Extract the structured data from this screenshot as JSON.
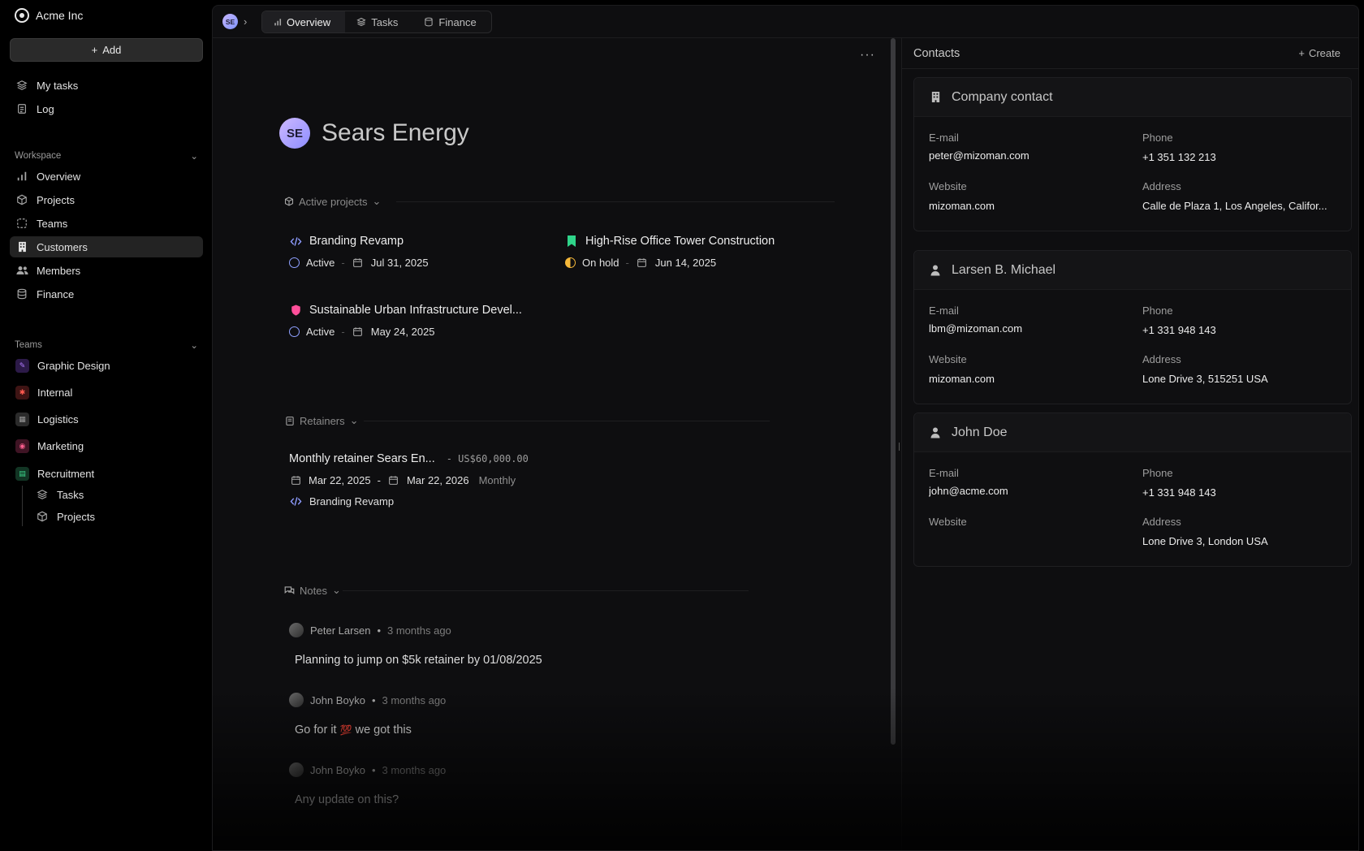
{
  "org": {
    "name": "Acme Inc"
  },
  "sidebar": {
    "add_label": "Add",
    "top_items": [
      {
        "label": "My tasks",
        "icon": "layers-icon"
      },
      {
        "label": "Log",
        "icon": "log-icon"
      }
    ],
    "workspace": {
      "heading": "Workspace",
      "items": [
        {
          "label": "Overview",
          "icon": "chart-icon"
        },
        {
          "label": "Projects",
          "icon": "box-icon"
        },
        {
          "label": "Teams",
          "icon": "teams-icon"
        },
        {
          "label": "Customers",
          "icon": "building-icon",
          "active": true
        },
        {
          "label": "Members",
          "icon": "members-icon"
        },
        {
          "label": "Finance",
          "icon": "database-icon"
        }
      ]
    },
    "teams": {
      "heading": "Teams",
      "items": [
        {
          "label": "Graphic Design",
          "color": "#8a4cf0"
        },
        {
          "label": "Internal",
          "color": "#e0413a"
        },
        {
          "label": "Logistics",
          "color": "#6f6f6f"
        },
        {
          "label": "Marketing",
          "color": "#e8457a"
        },
        {
          "label": "Recruitment",
          "color": "#2fbf71"
        }
      ],
      "sub_items": [
        {
          "label": "Tasks"
        },
        {
          "label": "Projects"
        }
      ]
    }
  },
  "topbar": {
    "avatar_initials": "SE",
    "tabs": [
      {
        "label": "Overview",
        "active": true
      },
      {
        "label": "Tasks"
      },
      {
        "label": "Finance"
      }
    ]
  },
  "customer": {
    "initials": "SE",
    "name": "Sears Energy"
  },
  "active_projects": {
    "heading": "Active projects",
    "projects": [
      {
        "name": "Branding Revamp",
        "status": "Active",
        "date": "Jul 31, 2025",
        "icon": "code-icon"
      },
      {
        "name": "High-Rise Office Tower Construction",
        "status": "On hold",
        "date": "Jun 14, 2025",
        "icon": "bookmark-icon"
      },
      {
        "name": "Sustainable Urban Infrastructure Devel...",
        "status": "Active",
        "date": "May 24, 2025",
        "icon": "shield-icon"
      }
    ]
  },
  "retainers": {
    "heading": "Retainers",
    "items": [
      {
        "name": "Monthly retainer Sears En...",
        "amount": "- US$60,000.00",
        "start": "Mar 22, 2025",
        "end": "Mar 22, 2026",
        "dash": "-",
        "frequency": "Monthly",
        "project": "Branding Revamp"
      }
    ]
  },
  "notes": {
    "heading": "Notes",
    "items": [
      {
        "author": "Peter Larsen",
        "time": "3 months ago",
        "body": "Planning to jump on $5k retainer by 01/08/2025"
      },
      {
        "author": "John Boyko",
        "time": "3 months ago",
        "body": "Go for it",
        "emoji": "💯",
        "body_after": "we got this"
      },
      {
        "author": "John Boyko",
        "time": "3 months ago",
        "body": "Any update on this?"
      }
    ]
  },
  "contacts": {
    "title": "Contacts",
    "create_label": "Create",
    "labels": {
      "email": "E-mail",
      "phone": "Phone",
      "website": "Website",
      "address": "Address"
    },
    "cards": [
      {
        "name": "Company contact",
        "icon": "building-icon",
        "email": "peter@mizoman.com",
        "phone": "+1 351 132 213",
        "website": "mizoman.com",
        "address": "Calle de Plaza 1, Los Angeles, Califor..."
      },
      {
        "name": "Larsen B. Michael",
        "icon": "person-icon",
        "email": "lbm@mizoman.com",
        "phone": "+1 331 948 143",
        "website": "mizoman.com",
        "address": "Lone Drive 3, 515251 USA"
      },
      {
        "name": "John Doe",
        "icon": "person-icon",
        "email": "john@acme.com",
        "phone": "+1 331 948 143",
        "website": "",
        "address": "Lone Drive 3, London USA"
      }
    ]
  }
}
